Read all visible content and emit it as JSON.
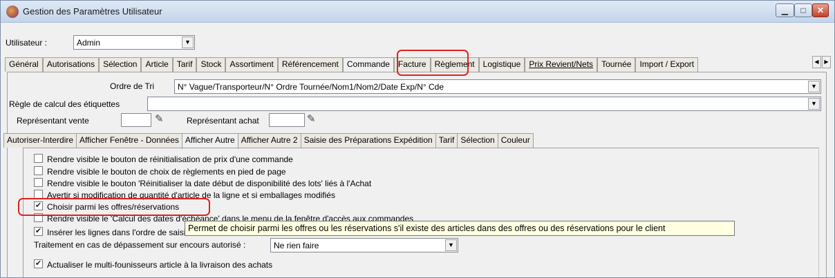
{
  "window": {
    "title": "Gestion des Paramètres Utilisateur",
    "controls": {
      "minimize": "▁",
      "maximize": "□",
      "close": "✕"
    }
  },
  "user": {
    "label": "Utilisateur :",
    "value": "Admin"
  },
  "tabs": [
    "Général",
    "Autorisations",
    "Sélection",
    "Article",
    "Tarif",
    "Stock",
    "Assortiment",
    "Référencement",
    "Commande",
    "Facture",
    "Règlement",
    "Logistique",
    "Prix Revient/Nets",
    "Tournée",
    "Import / Export"
  ],
  "active_tab": "Commande",
  "tab_scroll": {
    "left": "◀",
    "right": "▶"
  },
  "form": {
    "ordre_label": "Ordre de Tri",
    "ordre_value": "N° Vague/Transporteur/N° Ordre Tournée/Nom1/Nom2/Date Exp/N° Cde",
    "regle_label": "Règle de calcul des étiquettes",
    "regle_value": "",
    "rep_vente_label": "Représentant vente",
    "rep_achat_label": "Représentant achat"
  },
  "subtabs": [
    "Autoriser-Interdire",
    "Afficher Fenêtre - Données",
    "Afficher Autre",
    "Afficher Autre 2",
    "Saisie des Préparations Expédition",
    "Tarif",
    "Sélection",
    "Couleur"
  ],
  "active_subtab": "Afficher Autre",
  "options": [
    {
      "label": "Rendre visible le bouton de réinitialisation de prix d'une commande",
      "checked": false
    },
    {
      "label": "Rendre visible le bouton de choix de règlements en pied de page",
      "checked": false
    },
    {
      "label": "Rendre visible le bouton 'Réinitialiser la date début de disponibilité des lots' liés à l'Achat",
      "checked": false
    },
    {
      "label": "Avertir si modification de quantité d'article de la ligne et si emballages modifiés",
      "checked": false
    },
    {
      "label": "Choisir parmi les offres/réservations",
      "checked": true
    },
    {
      "label": "Rendre visible le 'Calcul des dates d'échéance' dans le menu de la fenêtre d'accès aux commandes",
      "checked": false
    },
    {
      "label": "Insérer les lignes dans l'ordre de saisie",
      "checked": true
    }
  ],
  "traitement": {
    "label": "Traitement en cas de dépassement sur encours autorisé :",
    "value": "Ne rien faire"
  },
  "actualiser": {
    "label": "Actualiser le multi-founisseurs article à la livraison des achats",
    "checked": true
  },
  "tooltip": "Permet de choisir parmi les offres ou les réservations s'il existe des articles dans des offres ou des réservations pour le client",
  "icons": {
    "app": "app-icon",
    "combo_arrow": "▼",
    "checkmark": "✔",
    "rep_search": "✎"
  },
  "accent_colors": {
    "highlight": "#e2201e",
    "tooltip_bg": "#ffffe1"
  }
}
